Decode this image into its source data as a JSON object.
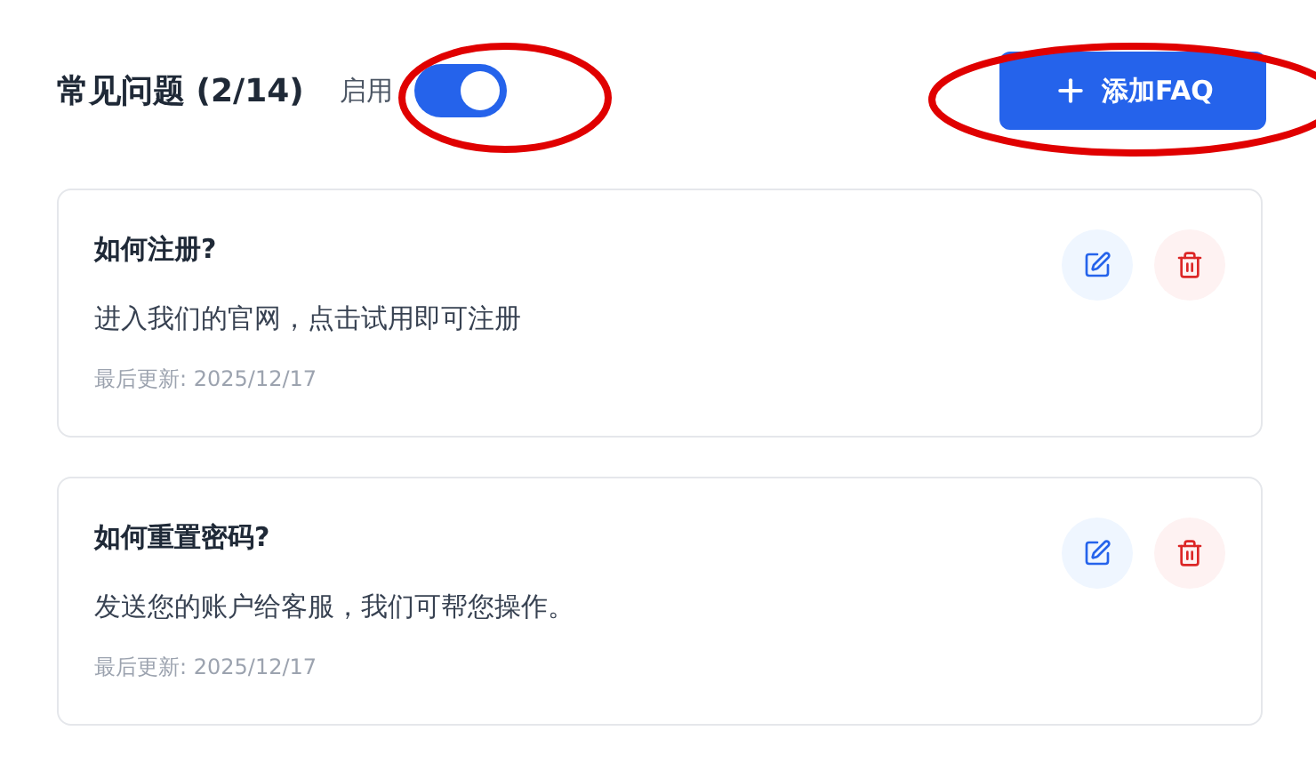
{
  "header": {
    "title": "常见问题 (2/14)",
    "toggle": {
      "label": "启用",
      "on": true
    },
    "add_button": "添加FAQ"
  },
  "faqs": [
    {
      "question": "如何注册?",
      "answer": "进入我们的官网，点击试用即可注册",
      "updated": "最后更新: 2025/12/17"
    },
    {
      "question": "如何重置密码?",
      "answer": "发送您的账户给客服，我们可帮您操作。",
      "updated": "最后更新: 2025/12/17"
    }
  ]
}
